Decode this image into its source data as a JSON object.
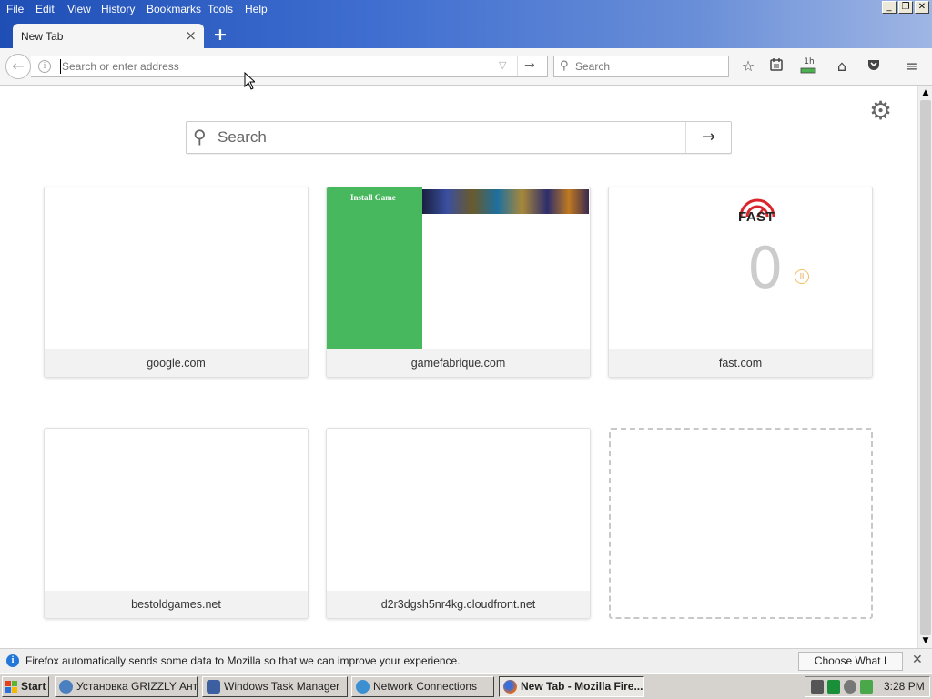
{
  "menubar": {
    "items": [
      "File",
      "Edit",
      "View",
      "History",
      "Bookmarks",
      "Tools",
      "Help"
    ],
    "window_controls": [
      "_",
      "❐",
      "✕"
    ]
  },
  "tabs": [
    {
      "label": "New Tab",
      "active": true
    }
  ],
  "navbar": {
    "url_placeholder": "Search or enter address",
    "url_value": "",
    "search_placeholder": "Search",
    "icons": [
      "back-icon",
      "info-icon",
      "dropdown-icon",
      "go-arrow-icon",
      "star-icon",
      "reading-list-icon",
      "download-icon",
      "home-icon",
      "pocket-icon",
      "menu-icon"
    ],
    "download_badge": "1h"
  },
  "newtab": {
    "search_placeholder": "Search",
    "tiles": [
      {
        "title": "google.com"
      },
      {
        "title": "gamefabrique.com",
        "thumb_button": "Install Game"
      },
      {
        "title": "fast.com",
        "logo_text": "FAST",
        "speed_value": "0"
      },
      {
        "title": "bestoldgames.net"
      },
      {
        "title": "d2r3dgsh5nr4kg.cloudfront.net"
      },
      {
        "title": ""
      }
    ]
  },
  "notification": {
    "text": "Firefox automatically sends some data to Mozilla so that we can improve your experience.",
    "button": "Choose What I Share"
  },
  "taskbar": {
    "start_label": "Start",
    "tasks": [
      {
        "label": "Установка GRIZZLY Ант...",
        "active": false
      },
      {
        "label": "Windows Task Manager",
        "active": false
      },
      {
        "label": "Network Connections",
        "active": false
      },
      {
        "label": "New Tab - Mozilla Fire...",
        "active": true
      }
    ],
    "clock": "3:28 PM"
  },
  "colors": {
    "titlebar_start": "#1f4fb5",
    "titlebar_end": "#9fb6e4",
    "gamefabrique_green": "#48b85f",
    "fast_red": "#d9262c",
    "info_blue": "#2377d8"
  }
}
